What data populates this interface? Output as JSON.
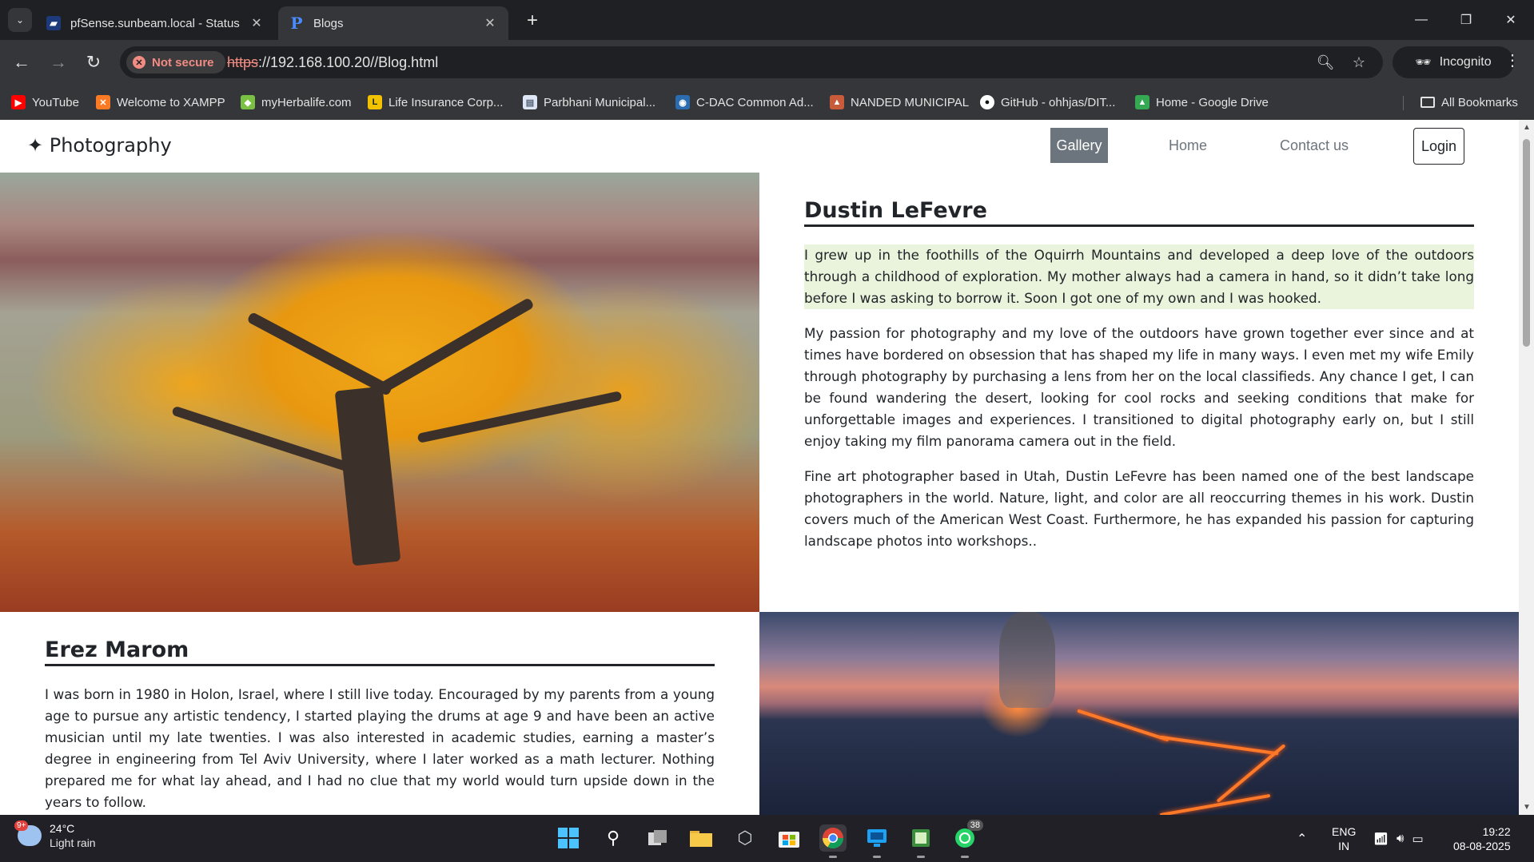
{
  "browser": {
    "tabs": [
      {
        "title": "pfSense.sunbeam.local - Status",
        "favicon": "pfsense-logo"
      },
      {
        "title": "Blogs",
        "favicon": "p-logo",
        "active": true
      }
    ],
    "security_label": "Not secure",
    "url_scheme": "https",
    "url_rest": "://192.168.100.20//Blog.html",
    "profile_label": "Incognito",
    "bookmarks": [
      {
        "label": "YouTube",
        "icon": "youtube-icon",
        "color": "#ff0000"
      },
      {
        "label": "Welcome to XAMPP",
        "icon": "xampp-icon",
        "color": "#fb7a24"
      },
      {
        "label": "myHerbalife.com",
        "icon": "herbalife-icon",
        "color": "#7ac143"
      },
      {
        "label": "Life Insurance Corp...",
        "icon": "lic-icon",
        "color": "#f2c200"
      },
      {
        "label": "Parbhani Municipal...",
        "icon": "page-icon",
        "color": "#dfe6f5"
      },
      {
        "label": "C-DAC Common Ad...",
        "icon": "cdac-icon",
        "color": "#2b6cb0"
      },
      {
        "label": "NANDED MUNICIPAL",
        "icon": "emblem-icon",
        "color": "#c75b3a"
      },
      {
        "label": "GitHub - ohhjas/DIT...",
        "icon": "github-icon",
        "color": "#ffffff"
      },
      {
        "label": "Home - Google Drive",
        "icon": "drive-icon",
        "color": "#34a853"
      }
    ],
    "all_bookmarks_label": "All Bookmarks"
  },
  "site": {
    "brand": "✦ Photography",
    "nav": [
      {
        "label": "Gallery",
        "active": true
      },
      {
        "label": "Home"
      },
      {
        "label": "Contact us"
      }
    ],
    "login_label": "Login"
  },
  "articles": [
    {
      "name": "Dustin LeFevre",
      "paragraphs": [
        "I grew up in the foothills of the Oquirrh Mountains and developed a deep love of the outdoors through a childhood of exploration. My mother always had a camera in hand, so it didn’t take long before I was asking to borrow it. Soon I got one of my own and I was hooked.",
        "My passion for photography and my love of the outdoors have grown together ever since and at times have bordered on obsession that has shaped my life in many ways. I even met my wife Emily through photography by purchasing a lens from her on the local classifieds. Any chance I get, I can be found wandering the desert, looking for cool rocks and seeking conditions that make for unforgettable images and experiences. I transitioned to digital photography early on, but I still enjoy taking my film panorama camera out in the field.",
        "Fine art photographer based in Utah, Dustin LeFevre has been named one of the best landscape photographers in the world. Nature, light, and color are all reoccurring themes in his work. Dustin covers much of the American West Coast. Furthermore, he has expanded his passion for capturing landscape photos into workshops.."
      ]
    },
    {
      "name": "Erez Marom",
      "paragraphs": [
        "I was born in 1980 in Holon, Israel, where I still live today. Encouraged by my parents from a young age to pursue any artistic tendency, I started playing the drums at age 9 and have been an active musician until my late twenties. I was also interested in academic studies, earning a master’s degree in engineering from Tel Aviv University, where I later worked as a math lecturer. Nothing prepared me for what lay ahead, and I had no clue that my world would turn upside down in the years to follow."
      ]
    }
  ],
  "taskbar": {
    "weather_temp": "24°C",
    "weather_desc": "Light rain",
    "weather_badge": "9+",
    "whatsapp_badge": "38",
    "lang_top": "ENG",
    "lang_bottom": "IN",
    "time": "19:22",
    "date": "08-08-2025"
  }
}
